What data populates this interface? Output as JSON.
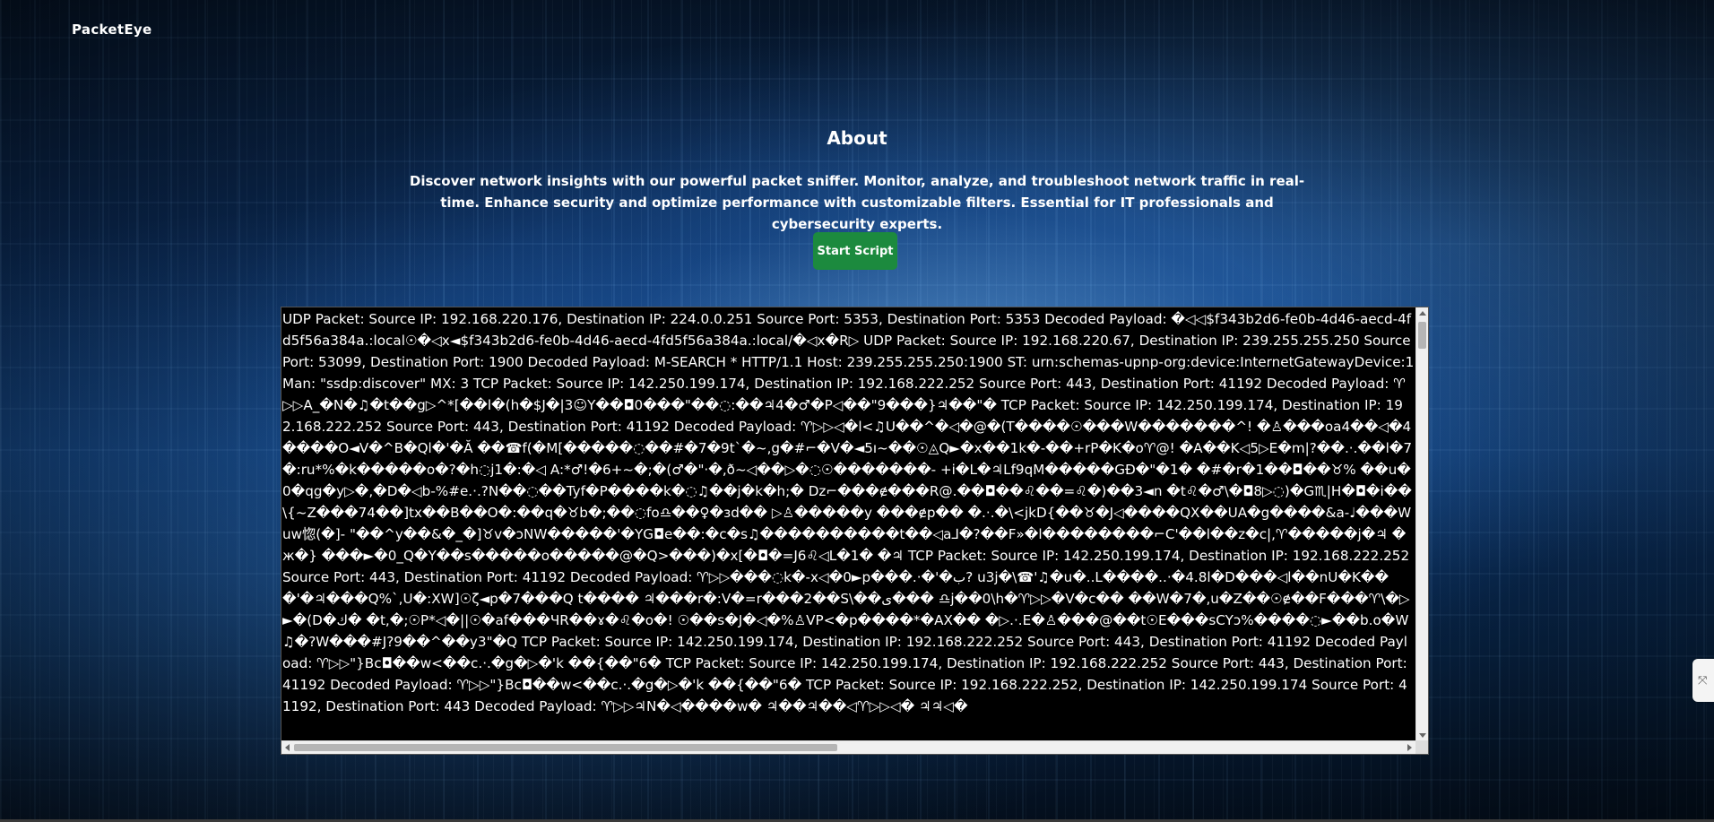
{
  "header": {
    "brand": "PacketEye"
  },
  "about": {
    "title": "About",
    "description": "Discover network insights with our powerful packet sniffer. Monitor, analyze, and troubleshoot network traffic in real-time. Enhance security and optimize performance with customizable filters. Essential for IT professionals and cybersecurity experts."
  },
  "actions": {
    "start_label": "Start Script"
  },
  "output": {
    "text": "UDP Packet: Source IP: 192.168.220.176, Destination IP: 224.0.0.251 Source Port: 5353, Destination Port: 5353 Decoded Payload: �◁◁$f343b2d6-fe0b-4d46-aecd-4fd5f56a384a.:local☉�◁x◄$f343b2d6-fe0b-4d46-aecd-4fd5f56a384a.:local/�◁x�R▷ UDP Packet: Source IP: 192.168.220.67, Destination IP: 239.255.255.250 Source Port: 53099, Destination Port: 1900 Decoded Payload: M-SEARCH * HTTP/1.1 Host: 239.255.255.250:1900 ST: urn:schemas-upnp-org:device:InternetGatewayDevice:1 Man: \"ssdp:discover\" MX: 3 TCP Packet: Source IP: 142.250.199.174, Destination IP: 192.168.222.252 Source Port: 443, Destination Port: 41192 Decoded Payload: ♈▷▷A_�N�♫�t��g▷^*[��l�(h�$J�|3☺Y��◘0���\"��◌:��♃4�♂�P◁��\"9���}♃��\"� TCP Packet: Source IP: 142.250.199.174, Destination IP: 192.168.222.252 Source Port: 443, Destination Port: 41192 Decoded Payload: ♈▷▷◁�l<♫U��^�◁�@�(T����☉���W�������^! �♙���oa4��◁�4����O◄V�^B�Ql�'�Ă ��☎f(�M[�����◌��#�7�9t`�~,g�#⌐�V�◄5ı~��☉◬Q►�x��1k�-��+rP�K�o♈@! �A��K◁5▷E�m|?��.·.��l�7�:ru*%�k�����o�?�h◌j1�:�◁ A:*♂!�6+~�;�(♂�\"·�,ð~◁��▷�◌☉�������- +i�L�♃Lf9qM�����GĐ�\"�1� �#�r�1��◘��♉% ��u�0�qg�y▷�,�D�◁b-%#e.·.?N��◌��Tyf�P����k�◌♫��j�k�h;� Dz⌐���ɇ���R@.��◘��♌��=♌�)��3◄n �t♌�♂\\�◘8▷◌)�G♏|H�◘�i��\\{~Z���74��]tx��B��O�:��q�♉b�;��◌fo♎��♀�ɜd�� ▷♙�����y ���ɇp�� �.·.�\\<jkD{��♉�J◁����QX��UA�g����&a-♩���Wuw惚(�]- \"��^y��&�_�]♉v�ɔNW�����'�YG◘e��:�c�s♫����������t��◁a⅃�?��F»�l��������⌐C'��l��z�c|,♈�����j�♃ �ж�} ���►�0_Q�Y��s�����o�����@�Q>���)�x[�◘�=J6♌◁L�1� �♃ TCP Packet: Source IP: 142.250.199.174, Destination IP: 192.168.222.252 Source Port: 443, Destination Port: 41192 Decoded Payload: ♈▷▷���◌k�-x◁�0►p���.·�'�ب? u3j�\\☎'♫�u�..L����..·�4.8l�D���◁l��nU�K���'�♃���Q%`,U�:XW]☉ζ◄p�7���Q t���� ♃���r�:V�=r���2��S\\��ى��� ♎j��0\\h�♈▷▷�V�c�� ��W�7�,u�Z��☉ɇ��F���♈\\�▷►�(D�ك� �t,�;☉P*◁�||☉�af���ЧR��ɤ�♌�o�! ☉��s�J�◁�%♙VP<�p����*�AX�� �▷.·.E�♙���@��t☉E���sCYɔ%����◌►��b.o�W♫�?W���#J?9��^��y3\"�Q TCP Packet: Source IP: 142.250.199.174, Destination IP: 192.168.222.252 Source Port: 443, Destination Port: 41192 Decoded Payload: ♈▷▷\"}Bc◘��w<��c.·.�g�▷�'k ��{��\"6� TCP Packet: Source IP: 142.250.199.174, Destination IP: 192.168.222.252 Source Port: 443, Destination Port: 41192 Decoded Payload: ♈▷▷\"}Bc◘��w<��c.·.�g�▷�'k ��{��\"6� TCP Packet: Source IP: 192.168.222.252, Destination IP: 142.250.199.174 Source Port: 41192, Destination Port: 443 Decoded Payload: ♈▷▷♃N�◁����w� ♃��♃��◁♈▷▷◁� ♃♃◁�"
  },
  "icons": {
    "side_tab": "side-panel-toggle-icon"
  }
}
